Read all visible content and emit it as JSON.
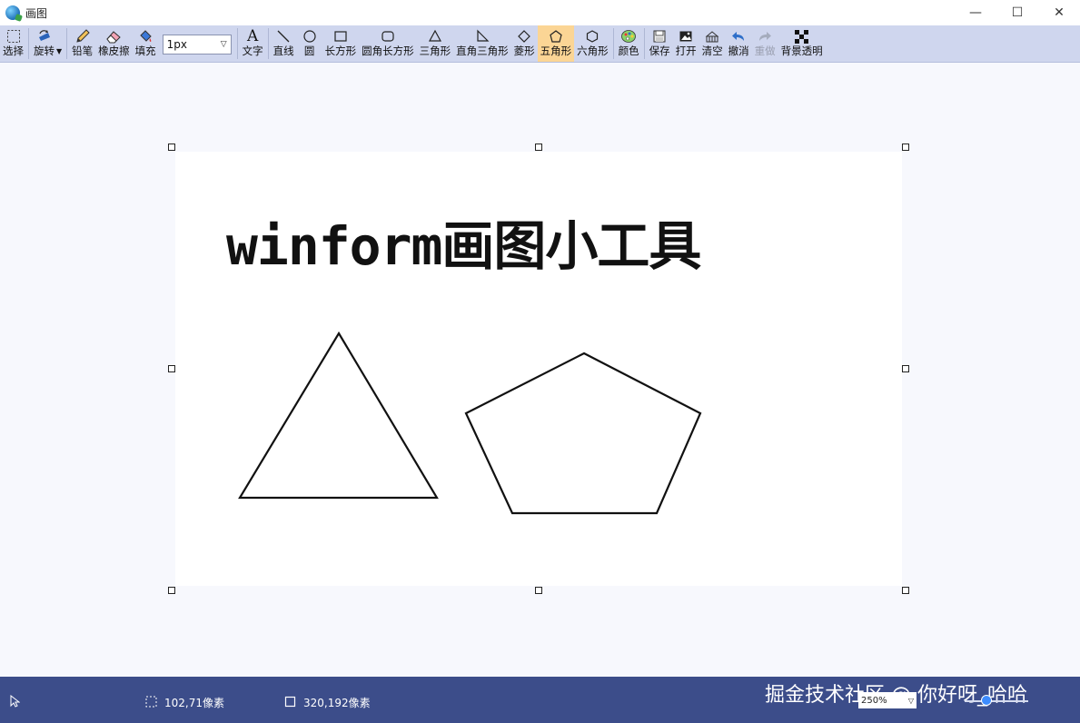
{
  "window": {
    "title": "画图",
    "controls": {
      "minimize": "—",
      "maximize": "☐",
      "close": "✕"
    }
  },
  "toolbar": {
    "select": "选择",
    "rotate": "旋转",
    "pencil": "铅笔",
    "eraser": "橡皮擦",
    "fill": "填充",
    "brush_size": "1px",
    "text": "文字",
    "line": "直线",
    "circle": "圆",
    "rectangle": "长方形",
    "rounded_rectangle": "圆角长方形",
    "triangle": "三角形",
    "right_triangle": "直角三角形",
    "diamond": "菱形",
    "pentagon": "五角形",
    "hexagon": "六角形",
    "color": "颜色",
    "save": "保存",
    "open": "打开",
    "clear": "清空",
    "undo": "撤消",
    "redo": "重做",
    "bg_transparent": "背景透明",
    "active_tool": "pentagon",
    "active_color": "#fbd595"
  },
  "canvas": {
    "text": "winform画图小工具"
  },
  "statusbar": {
    "selection_size": "102,71像素",
    "canvas_size": "320,192像素",
    "zoom": "250%",
    "watermark": "掘金技术社区 @ 你好呀_哈哈"
  },
  "colors": {
    "toolbar_bg": "#cfd6ee",
    "status_bg": "#3c4d8a",
    "canvas_bg": "#f7f8fd"
  }
}
